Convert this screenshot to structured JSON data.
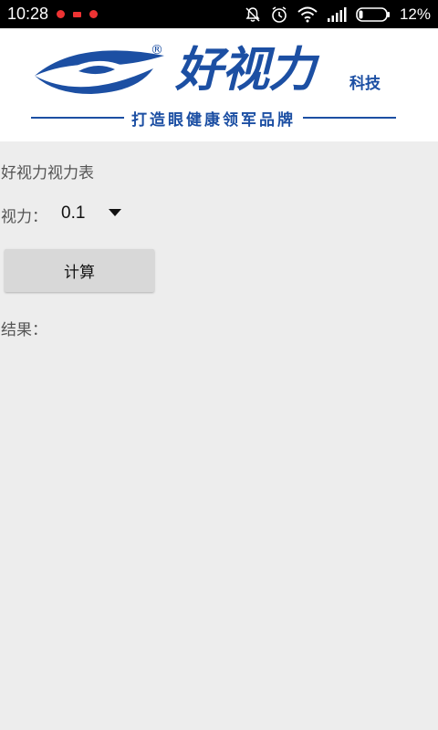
{
  "status_bar": {
    "time": "10:28",
    "battery": "12%"
  },
  "banner": {
    "brand_name": "好视力",
    "brand_suffix": "科技",
    "registered_mark": "®",
    "slogan": "打造眼健康领军品牌",
    "brand_color": "#1c4fa3"
  },
  "main": {
    "title": "好视力视力表",
    "vision_label": "视力：",
    "vision_value": "0.1",
    "calc_button_label": "计算",
    "result_label": "结果："
  }
}
